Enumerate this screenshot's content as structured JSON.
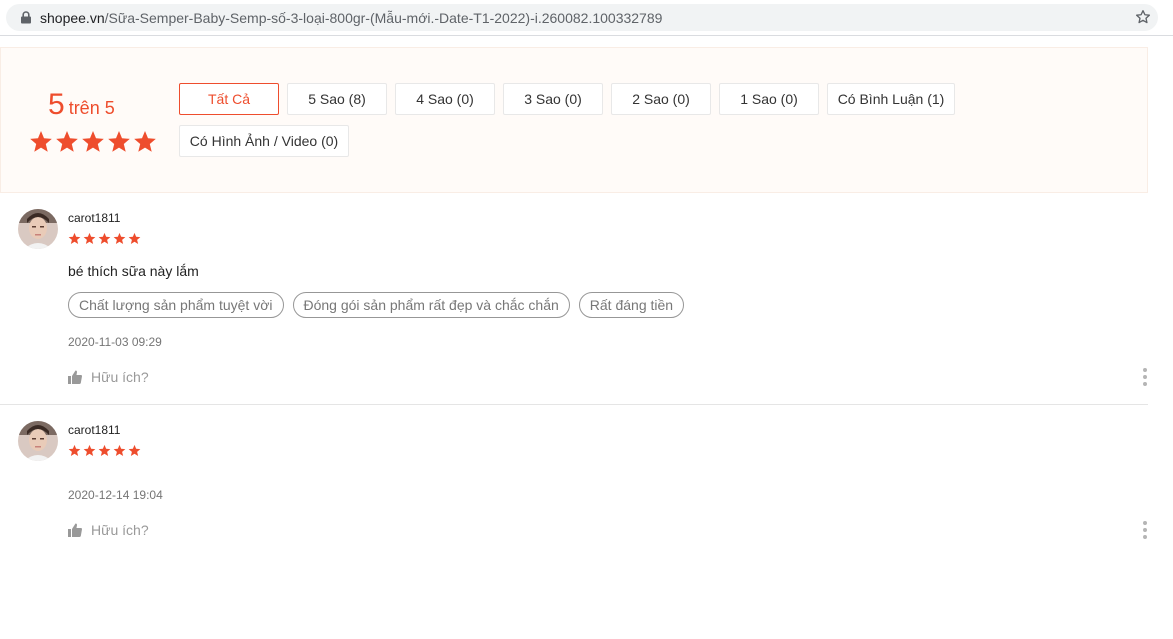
{
  "browser": {
    "url_host": "shopee.vn",
    "url_path": "/Sữa-Semper-Baby-Semp-số-3-loại-800gr-(Mẫu-mới.-Date-T1-2022)-i.260082.100332789"
  },
  "rating_overview": {
    "score": "5",
    "score_suffix": "trên 5",
    "star_count": 5,
    "accent_color": "#ee4d2d",
    "filters": [
      {
        "label": "Tất Cả",
        "active": true
      },
      {
        "label": "5 Sao (8)",
        "active": false
      },
      {
        "label": "4 Sao (0)",
        "active": false
      },
      {
        "label": "3 Sao (0)",
        "active": false
      },
      {
        "label": "2 Sao (0)",
        "active": false
      },
      {
        "label": "1 Sao (0)",
        "active": false
      },
      {
        "label": "Có Bình Luận (1)",
        "active": false
      },
      {
        "label": "Có Hình Ảnh / Video (0)",
        "active": false
      }
    ]
  },
  "reviews": [
    {
      "username": "carot1811",
      "rating": 5,
      "comment": "bé thích sữa này lắm",
      "tags": [
        "Chất lượng sản phẩm tuyệt vời",
        "Đóng gói sản phẩm rất đẹp và chắc chắn",
        "Rất đáng tiền"
      ],
      "date": "2020-11-03 09:29",
      "helpful_label": "Hữu ích?"
    },
    {
      "username": "carot1811",
      "rating": 5,
      "comment": "",
      "tags": [],
      "date": "2020-12-14 19:04",
      "helpful_label": "Hữu ích?"
    }
  ]
}
